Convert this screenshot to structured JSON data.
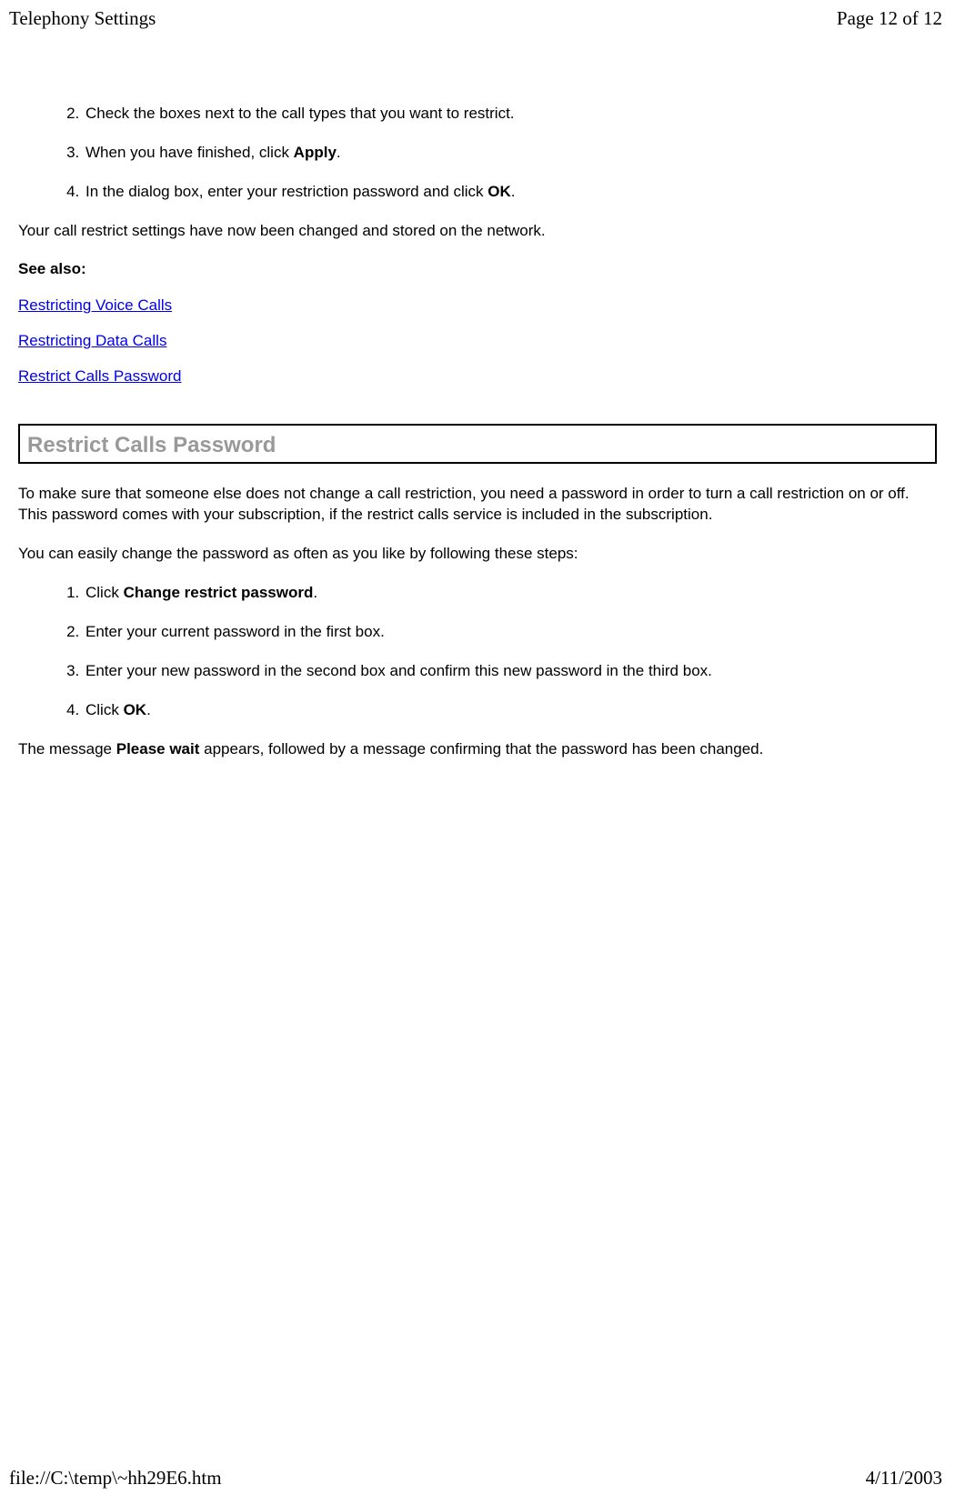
{
  "header": {
    "title": "Telephony Settings",
    "page_indicator": "Page 12 of 12"
  },
  "steps1": {
    "n2": "Check the boxes next to the call types that you want to restrict.",
    "n3_prefix": "When you have finished, click ",
    "n3_bold": "Apply",
    "n3_suffix": ".",
    "n4_prefix": "In the dialog box, enter your restriction password and click ",
    "n4_bold": "OK",
    "n4_suffix": "."
  },
  "para1": "Your call restrict settings have now been changed and stored on the network.",
  "see_also_label": "See also:",
  "links": {
    "l1": "Restricting Voice Calls",
    "l2": "Restricting Data Calls",
    "l3": "Restrict Calls Password"
  },
  "section_title": "Restrict Calls Password",
  "para2": "To make sure that someone else does not change a call restriction, you need a password in order to turn a call restriction on or off. This password comes with your subscription, if the restrict calls service is included in the subscription.",
  "para3": "You can easily change the password as often as you like by following these steps:",
  "steps2": {
    "n1_prefix": "Click ",
    "n1_bold": "Change restrict password",
    "n1_suffix": ".",
    "n2": "Enter your current password in the first box.",
    "n3": "Enter your new password in the second box and confirm this new password in the third box.",
    "n4_prefix": "Click ",
    "n4_bold": "OK",
    "n4_suffix": "."
  },
  "para4_prefix": "The message ",
  "para4_bold": "Please wait",
  "para4_suffix": " appears, followed by a message confirming that the password has been changed.",
  "footer": {
    "path": "file://C:\\temp\\~hh29E6.htm",
    "date": "4/11/2003"
  }
}
